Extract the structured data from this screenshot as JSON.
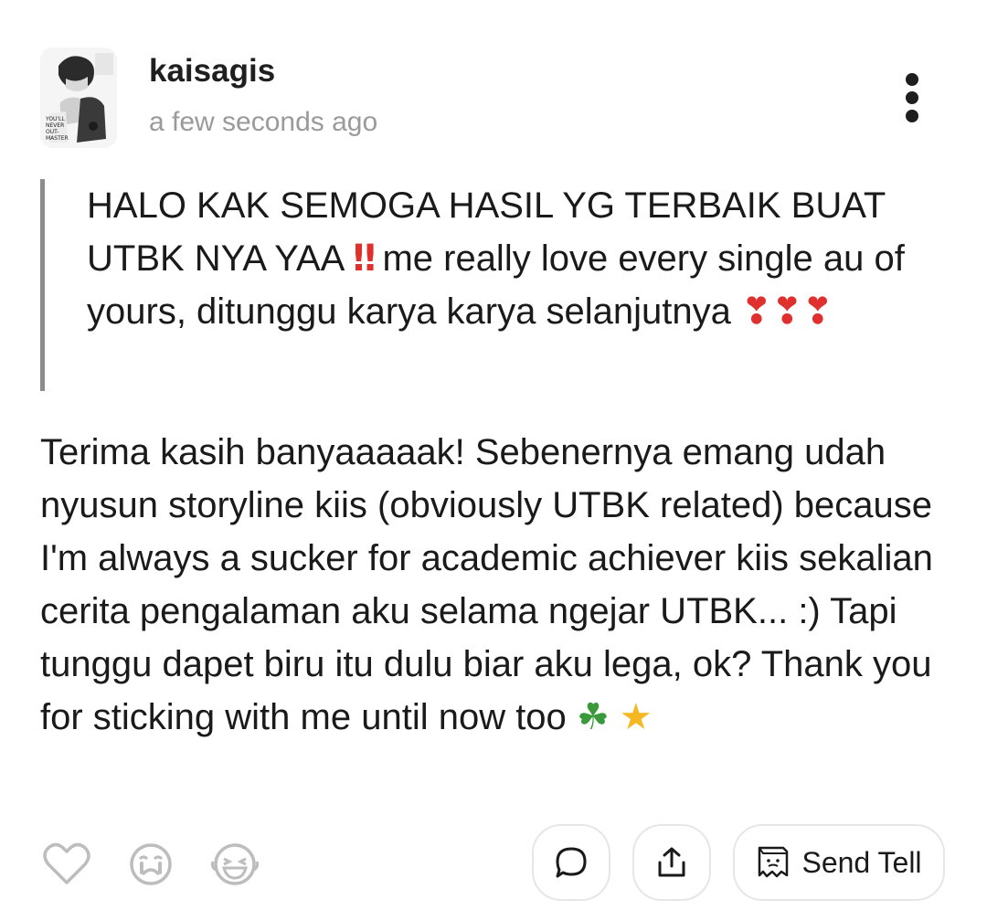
{
  "post": {
    "username": "kaisagis",
    "timestamp": "a few seconds ago",
    "avatar_text": "YOU'LL NEVER OUT-MASTER US"
  },
  "question": {
    "text": "HALO KAK SEMOGA HASIL YG TERBAIK BUAT UTBK NYA YAA",
    "emoji_bang": "‼",
    "text_after": " me really love every single au of yours, ditunggu karya karya selanjutnya",
    "hearts": "❣❣❣"
  },
  "answer": {
    "text": "Terima kasih banyaaaaak! Sebenernya emang udah nyusun storyline kiis (obviously UTBK related) because I'm always a sucker for academic achiever kiis sekalian cerita pengalaman aku selama ngejar UTBK... :) Tapi tunggu dapet biru itu dulu biar aku lega, ok? Thank you for sticking with me until now too",
    "clover": "☘",
    "star": "★"
  },
  "reactions": [
    {
      "icon": "heart-outline-icon"
    },
    {
      "icon": "crying-face-icon"
    },
    {
      "icon": "laughing-face-icon"
    }
  ],
  "actions": {
    "comment_icon": "comment-bubble-icon",
    "share_icon": "share-upload-icon",
    "send_tell_label": "Send Tell",
    "send_tell_icon": "ghost-note-icon"
  },
  "colors": {
    "accent_red": "#e0302e",
    "muted_gray": "#9a9a9a",
    "quote_bar": "#8c8c8c",
    "border": "#e6e6e6"
  }
}
